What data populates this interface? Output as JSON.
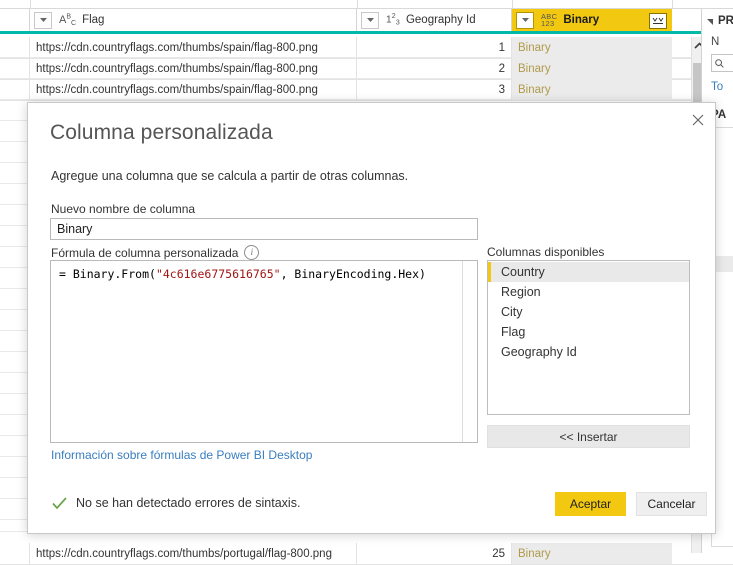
{
  "grid": {
    "columns": [
      {
        "label": "Flag",
        "type_icon": "abc-text-icon",
        "highlighted": false
      },
      {
        "label": "Geography Id",
        "type_icon": "123-number-icon",
        "highlighted": false
      },
      {
        "label": "Binary",
        "type_icon": "abc123-any-icon",
        "highlighted": true
      }
    ],
    "rows": [
      {
        "flag": "https://cdn.countryflags.com/thumbs/spain/flag-800.png",
        "geography_id": "1",
        "binary": "Binary"
      },
      {
        "flag": "https://cdn.countryflags.com/thumbs/spain/flag-800.png",
        "geography_id": "2",
        "binary": "Binary"
      },
      {
        "flag": "https://cdn.countryflags.com/thumbs/spain/flag-800.png",
        "geography_id": "3",
        "binary": "Binary"
      }
    ],
    "bottom_row": {
      "flag": "https://cdn.countryflags.com/thumbs/portugal/flag-800.png",
      "geography_id": "25",
      "binary": "Binary"
    },
    "accent_color": "#00b9a9",
    "highlight_color": "#f2c811"
  },
  "side_panel": {
    "properties_title": "PR",
    "name_label": "N",
    "all_properties_link": "To",
    "steps_title": "PA"
  },
  "dialog": {
    "title": "Columna personalizada",
    "description": "Agregue una columna que se calcula a partir de otras columnas.",
    "new_column_name_label": "Nuevo nombre de columna",
    "new_column_name_value": "Binary",
    "new_column_name_placeholder": "Nuevo nombre de columna",
    "formula_label": "Fórmula de columna personalizada",
    "formula_prefix": "= Binary.From(",
    "formula_string": "\"4c616e6775616765\"",
    "formula_suffix": ", BinaryEncoding.Hex)",
    "formula_full": "= Binary.From(\"4c616e6775616765\", BinaryEncoding.Hex)",
    "help_link": "Información sobre fórmulas de Power BI Desktop",
    "available_columns_label": "Columnas disponibles",
    "available_columns": [
      {
        "label": "Country",
        "selected": true
      },
      {
        "label": "Region",
        "selected": false
      },
      {
        "label": "City",
        "selected": false
      },
      {
        "label": "Flag",
        "selected": false
      },
      {
        "label": "Geography Id",
        "selected": false
      }
    ],
    "insert_label": "<< Insertar",
    "status_message": "No se han detectado errores de sintaxis.",
    "ok_label": "Aceptar",
    "cancel_label": "Cancelar",
    "close_label": "Cerrar"
  }
}
